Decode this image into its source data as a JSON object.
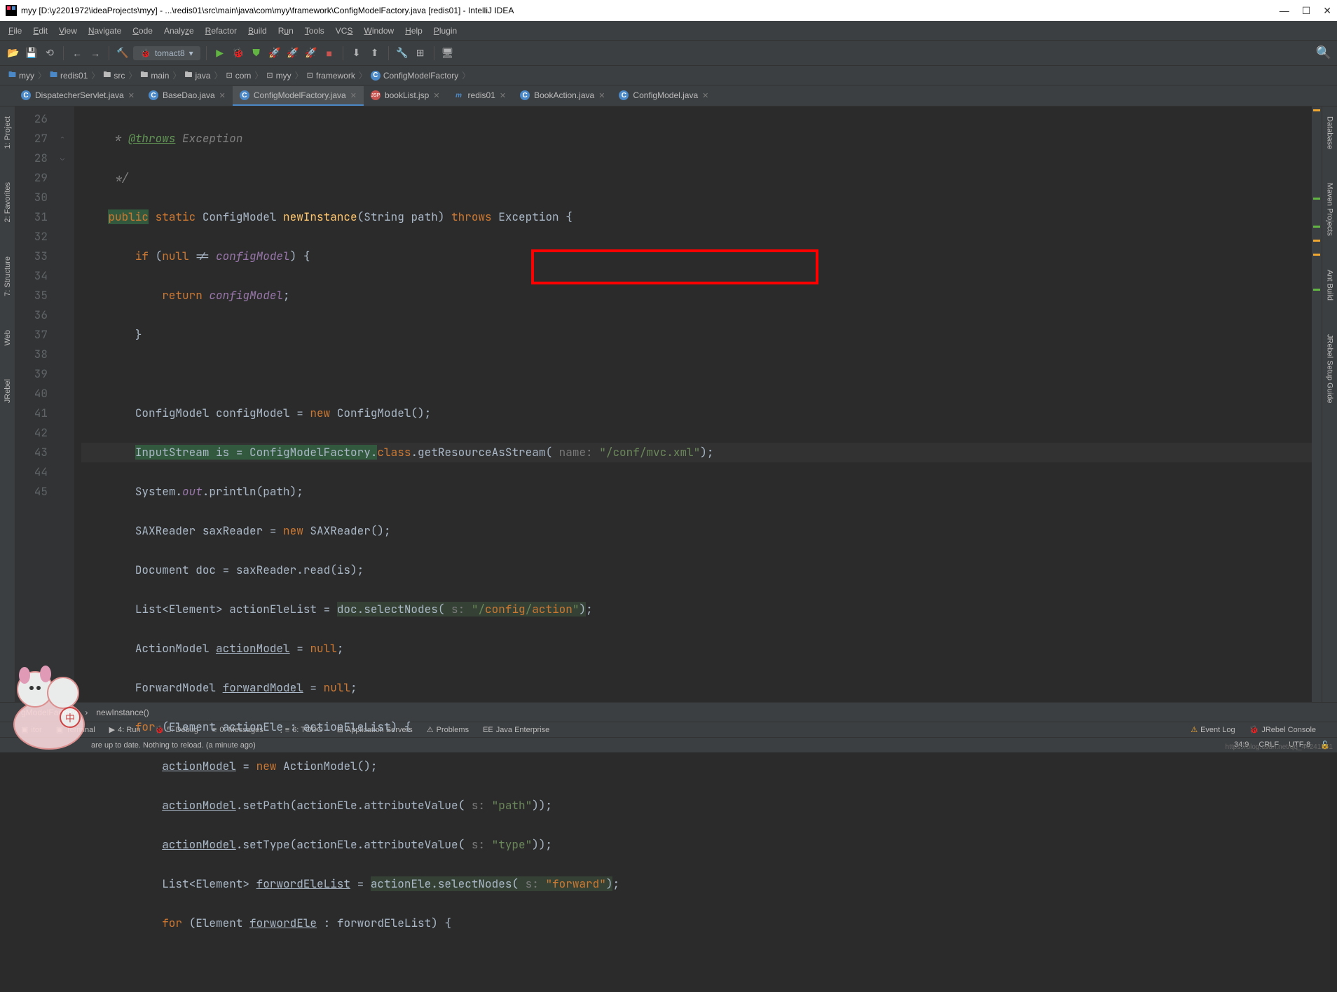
{
  "titlebar": {
    "text": "myy [D:\\y2201972\\ideaProjects\\myy] - ...\\redis01\\src\\main\\java\\com\\myy\\framework\\ConfigModelFactory.java [redis01] - IntelliJ IDEA"
  },
  "menubar": [
    "File",
    "Edit",
    "View",
    "Navigate",
    "Code",
    "Analyze",
    "Refactor",
    "Build",
    "Run",
    "Tools",
    "VCS",
    "Window",
    "Help",
    "Plugin"
  ],
  "toolbar": {
    "run_config": "tomact8"
  },
  "breadcrumbs": [
    "myy",
    "redis01",
    "src",
    "main",
    "java",
    "com",
    "myy",
    "framework",
    "ConfigModelFactory"
  ],
  "tabs": [
    {
      "icon": "c",
      "label": "DispatecherServlet.java",
      "active": false
    },
    {
      "icon": "c",
      "label": "BaseDao.java",
      "active": false
    },
    {
      "icon": "c",
      "label": "ConfigModelFactory.java",
      "active": true
    },
    {
      "icon": "jsp",
      "label": "bookList.jsp",
      "active": false
    },
    {
      "icon": "m",
      "label": "redis01",
      "active": false
    },
    {
      "icon": "c",
      "label": "BookAction.java",
      "active": false
    },
    {
      "icon": "c",
      "label": "ConfigModel.java",
      "active": false
    }
  ],
  "line_numbers": [
    "26",
    "27",
    "28",
    "29",
    "30",
    "31",
    "32",
    "33",
    "34",
    "35",
    "36",
    "37",
    "38",
    "39",
    "40",
    "41",
    "42",
    "43",
    "44",
    "45"
  ],
  "code": {
    "l26_tag": "@throws",
    "l26_rest": " Exception",
    "l27": "*/",
    "l28_public": "public",
    "l28_static": " static",
    "l28_rest1": " ConfigModel ",
    "l28_method": "newInstance",
    "l28_rest2": "(String path) ",
    "l28_throws": "throws",
    "l28_rest3": " Exception {",
    "l29_if": "if",
    "l29_null": "null",
    "l29_cm": "configModel",
    "l29_neq": " != ",
    "l29_close": ") {",
    "l30_return": "return",
    "l30_cm": "configModel",
    "l31": "}",
    "l33_1": "ConfigModel configModel = ",
    "l33_new": "new",
    "l33_2": " ConfigModel();",
    "l34_1": "InputStream is = ConfigModelFactory.",
    "l34_class": "class",
    "l34_2": ".getResourceAsStream(",
    "l34_hint": " name: ",
    "l34_str": "\"/conf/mvc.xml\"",
    "l34_3": ");",
    "l35_1": "System.",
    "l35_out": "out",
    "l35_2": ".println(path);",
    "l36_1": "SAXReader saxReader = ",
    "l36_new": "new",
    "l36_2": " SAXReader();",
    "l37": "Document doc = saxReader.read(is);",
    "l38_1": "List<Element> actionEleList = ",
    "l38_doc": "doc.selectNodes(",
    "l38_hint": " s: ",
    "l38_str_a": "\"/",
    "l38_str_b": "config",
    "l38_str_c": "/",
    "l38_str_d": "action",
    "l38_str_e": "\"",
    "l38_end": ")",
    "l38_semi": ";",
    "l39_1": "ActionModel ",
    "l39_var": "actionModel",
    "l39_2": " = ",
    "l39_null": "null",
    "l39_3": ";",
    "l40_1": "ForwardModel ",
    "l40_var": "forwardModel",
    "l40_2": " = ",
    "l40_null": "null",
    "l40_3": ";",
    "l41_for": "for",
    "l41_1": " (Element actionEle : actionEleList) {",
    "l42_var": "actionModel",
    "l42_1": " = ",
    "l42_new": "new",
    "l42_2": " ActionModel();",
    "l43_var": "actionModel",
    "l43_1": ".setPath(actionEle.attributeValue(",
    "l43_hint": " s: ",
    "l43_str": "\"path\"",
    "l43_2": "));",
    "l44_var": "actionModel",
    "l44_1": ".setType(actionEle.attributeValue(",
    "l44_hint": " s: ",
    "l44_str": "\"type\"",
    "l44_2": "));",
    "l45_1": "List<Element> ",
    "l45_var": "forwordEleList",
    "l45_2": " = ",
    "l45_sel": "actionEle.selectNodes(",
    "l45_hint": " s: ",
    "l45_str": "\"forward\"",
    "l45_end": ")",
    "l45_semi": ";",
    "l46_for": "for",
    "l46_1": " (Element ",
    "l46_var": "forwordEle",
    "l46_2": " : forwordEleList) {"
  },
  "minibar": {
    "path": "gModelFactory",
    "sep": "›",
    "method": "newInstance()"
  },
  "left_tools": [
    "1: Project",
    "2: Favorites",
    "7: Structure",
    "Web",
    "JRebel"
  ],
  "right_tools": [
    "Database",
    "Maven Projects",
    "Ant Build",
    "JRebel Setup Guide"
  ],
  "bottom_tools": [
    {
      "icon": "▣",
      "label": "itor"
    },
    {
      "icon": "▣",
      "label": "Terminal"
    },
    {
      "icon": "▶",
      "label": "4: Run"
    },
    {
      "icon": "🐞",
      "label": "5: Debug"
    },
    {
      "icon": "≡",
      "label": "0: Messages"
    },
    {
      "icon": "⋮≡",
      "label": "6: TODO"
    },
    {
      "icon": "⊞",
      "label": "Application Servers"
    },
    {
      "icon": "⚠",
      "label": "Problems"
    },
    {
      "icon": "EE",
      "label": "Java Enterprise"
    }
  ],
  "bottom_right": [
    {
      "icon": "⚠",
      "label": "Event Log",
      "color": "#f0a732"
    },
    {
      "icon": "🐞",
      "label": "JRebel Console",
      "color": "#62b543"
    }
  ],
  "statusbar": {
    "msg": "are up to date. Nothing to reload. (a minute ago)",
    "pos": "34:9",
    "crlf": "CRLF",
    "enc": "UTF-8",
    "watermark": "https://blog.csdn.net/qq_44241551"
  },
  "chart_data": null
}
